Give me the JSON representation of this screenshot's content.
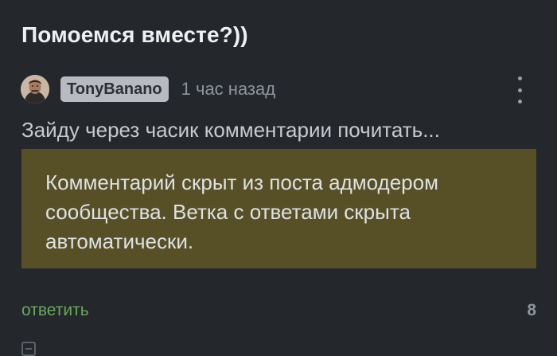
{
  "post": {
    "title": "Помоемся вместе?))"
  },
  "comment": {
    "username": "TonyBanano",
    "timestamp": "1 час назад",
    "text": "Зайду через часик комментарии почитать...",
    "hidden_notice": "Комментарий скрыт из поста адмодером сообщества. Ветка с ответами скрыта автоматически.",
    "reply_label": "ответить",
    "rating": "8",
    "avatar_icon": "user-avatar-photo",
    "menu_icon": "more-vertical-icon",
    "collapse_icon": "collapse-minus-icon"
  },
  "colors": {
    "background": "#24272b",
    "notice_background": "#575027",
    "reply_link": "#6aa85a",
    "username_badge": "#b7bbc1"
  }
}
